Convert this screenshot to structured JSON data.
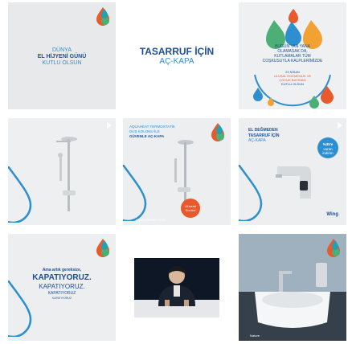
{
  "posts": [
    {
      "lines": [
        "DÜNYA",
        "EL HİJYENİ GÜNÜ",
        "KUTLU OLSUN"
      ]
    },
    {
      "lines": [
        "TASARRUF İÇİN",
        "AÇ-KAPA"
      ]
    },
    {
      "lines": [
        "BUGÜN YAN YANA",
        "OLAMASAK DA,",
        "KUTLAMALAR TÜM",
        "COŞKUSUYLA KALPLERİMİZDE"
      ],
      "sub": [
        "23 NİSAN",
        "ULUSAL EGEMENLİK VE",
        "ÇOCUK BAYRAMI",
        "KUTLU OLSUN"
      ]
    },
    {
      "lines": []
    },
    {
      "lines": [
        "AQUAHEAT TERMOSTATİK",
        "DUŞ KOLONU İLE",
        "GÜVENLE AÇ-KAPA"
      ],
      "badge": [
        "Güvenli",
        "Kontrol"
      ],
      "caption": "AquaHeat Elite 2500"
    },
    {
      "lines": [
        "EL DEĞMEDEN",
        "TASARRUF İÇİN",
        "AÇ-KAPA"
      ],
      "badge": [
        "%35'e",
        "varan",
        "indirim"
      ],
      "brand": "Wing"
    },
    {
      "lines": [
        "Ama artık gereksize,",
        "KAPATIYORUZ.",
        "KAPATIYORUZ.",
        "KAPATIYORUZ",
        "KAPATIYORUZ"
      ]
    },
    {
      "lines": []
    },
    {
      "lines": [],
      "caption": "Nature"
    }
  ],
  "colors": {
    "brand_blue": "#2d8fd0",
    "dark_blue": "#1e4f9a",
    "orange": "#e85a2c",
    "green": "#4caf76",
    "teal": "#1ea3b4"
  },
  "icons": [
    "play-icon",
    "water-drop-icon",
    "logo-drops-icon"
  ]
}
